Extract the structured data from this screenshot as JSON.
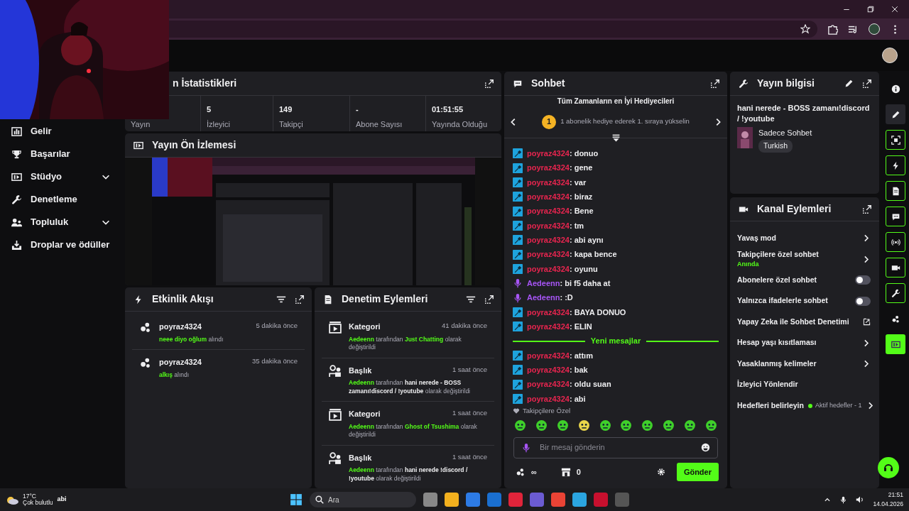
{
  "sidebar": {
    "items": [
      {
        "label": "Gelir",
        "expandable": false
      },
      {
        "label": "Başarılar",
        "expandable": false
      },
      {
        "label": "Stüdyo",
        "expandable": true
      },
      {
        "label": "Denetleme",
        "expandable": false
      },
      {
        "label": "Topluluk",
        "expandable": true
      },
      {
        "label": "Droplar ve ödüller",
        "expandable": false
      }
    ]
  },
  "stats": {
    "title": "n İstatistikleri",
    "items": [
      {
        "label": "Yayın"
      },
      {
        "value": "5",
        "label": "İzleyici"
      },
      {
        "value": "149",
        "label": "Takipçi"
      },
      {
        "value": "-",
        "label": "Abone Sayısı"
      },
      {
        "value": "01:51:55",
        "label": "Yayında Olduğu"
      }
    ]
  },
  "preview": {
    "title": "Yayın Ön İzlemesi"
  },
  "activity": {
    "title": "Etkinlik Akışı",
    "items": [
      {
        "user": "poyraz4324",
        "time": "5 dakika önce",
        "parts": [
          {
            "kind": "accent",
            "text": "neee diyo oğlum"
          },
          {
            "kind": "muted",
            "text": "alındı"
          }
        ]
      },
      {
        "user": "poyraz4324",
        "time": "35 dakika önce",
        "parts": [
          {
            "kind": "accent",
            "text": "alkış"
          },
          {
            "kind": "muted",
            "text": "alındı"
          }
        ]
      }
    ]
  },
  "moderation": {
    "title": "Denetim Eylemleri",
    "items": [
      {
        "kind": "category",
        "title": "Kategori",
        "time": "41 dakika önce",
        "parts": [
          {
            "kind": "accent",
            "text": "Aedeenn"
          },
          {
            "kind": "muted",
            "text": "tarafından"
          },
          {
            "kind": "accent",
            "text": "Just Chatting"
          },
          {
            "kind": "muted",
            "text": "olarak değiştirildi"
          }
        ]
      },
      {
        "kind": "title",
        "title": "Başlık",
        "time": "1 saat önce",
        "parts": [
          {
            "kind": "accent",
            "text": "Aedeenn"
          },
          {
            "kind": "muted",
            "text": "tarafından"
          },
          {
            "kind": "strong",
            "text": "hani nerede - BOSS zamanı!discord / !youtube"
          },
          {
            "kind": "muted",
            "text": "olarak değiştirildi"
          }
        ]
      },
      {
        "kind": "category",
        "title": "Kategori",
        "time": "1 saat önce",
        "parts": [
          {
            "kind": "accent",
            "text": "Aedeenn"
          },
          {
            "kind": "muted",
            "text": "tarafından"
          },
          {
            "kind": "accent",
            "text": "Ghost of Tsushima"
          },
          {
            "kind": "muted",
            "text": "olarak değiştirildi"
          }
        ]
      },
      {
        "kind": "title",
        "title": "Başlık",
        "time": "1 saat önce",
        "parts": [
          {
            "kind": "accent",
            "text": "Aedeenn"
          },
          {
            "kind": "muted",
            "text": "tarafından"
          },
          {
            "kind": "strong",
            "text": "hani nerede !discord / !youtube"
          },
          {
            "kind": "muted",
            "text": "olarak değiştirildi"
          }
        ]
      }
    ]
  },
  "chat": {
    "title": "Sohbet",
    "leaderboard": {
      "title": "Tüm Zamanların en İyi Hediyecileri",
      "rank": "1",
      "text": "1 abonelik hediye ederek 1. sıraya yükselin"
    },
    "messages": [
      {
        "kind": "moderator",
        "user": "poyraz4324",
        "color": "#e8254f",
        "text": ": donuo"
      },
      {
        "kind": "moderator",
        "user": "poyraz4324",
        "color": "#e8254f",
        "text": ": gene"
      },
      {
        "kind": "moderator",
        "user": "poyraz4324",
        "color": "#e8254f",
        "text": ": var"
      },
      {
        "kind": "moderator",
        "user": "poyraz4324",
        "color": "#e8254f",
        "text": ": biraz"
      },
      {
        "kind": "moderator",
        "user": "poyraz4324",
        "color": "#e8254f",
        "text": ": Bene"
      },
      {
        "kind": "moderator",
        "user": "poyraz4324",
        "color": "#e8254f",
        "text": ": tm"
      },
      {
        "kind": "moderator",
        "user": "poyraz4324",
        "color": "#e8254f",
        "text": ": abi aynı"
      },
      {
        "kind": "moderator",
        "user": "poyraz4324",
        "color": "#e8254f",
        "text": ": kapa bence"
      },
      {
        "kind": "moderator",
        "user": "poyraz4324",
        "color": "#e8254f",
        "text": ": oyunu"
      },
      {
        "kind": "broadcaster",
        "user": "Aedeenn",
        "color": "#a855f7",
        "text": ": bi f5 daha at"
      },
      {
        "kind": "broadcaster",
        "user": "Aedeenn",
        "color": "#a855f7",
        "text": ": :D"
      },
      {
        "kind": "moderator",
        "user": "poyraz4324",
        "color": "#e8254f",
        "text": ": BAYA DONUO"
      },
      {
        "kind": "moderator",
        "user": "poyraz4324",
        "color": "#e8254f",
        "text": ": ELIN"
      },
      {
        "kind": "divider",
        "text": "Yeni mesajlar"
      },
      {
        "kind": "moderator",
        "user": "poyraz4324",
        "color": "#e8254f",
        "text": ": attım"
      },
      {
        "kind": "moderator",
        "user": "poyraz4324",
        "color": "#e8254f",
        "text": ": bak"
      },
      {
        "kind": "moderator",
        "user": "poyraz4324",
        "color": "#e8254f",
        "text": ": oldu suan"
      },
      {
        "kind": "moderator",
        "user": "poyraz4324",
        "color": "#e8254f",
        "text": ": abi"
      }
    ],
    "emote_set": "Takipçilere Özel",
    "placeholder": "Bir mesaj gönderin",
    "points": "∞",
    "store_count": "0",
    "send": "Gönder"
  },
  "stream_info": {
    "title": "Yayın bilgisi",
    "stream_title": "hani nerede - BOSS zamanı!discord / !youtube",
    "category": "Sadece Sohbet",
    "tag": "Turkish"
  },
  "channel_actions": {
    "title": "Kanal Eylemleri",
    "items": [
      {
        "kind": "link",
        "label": "Yavaş mod"
      },
      {
        "kind": "link",
        "label": "Takipçilere özel sohbet",
        "sublabel": "Anında"
      },
      {
        "kind": "toggle",
        "label": "Abonelere özel sohbet",
        "on": false
      },
      {
        "kind": "toggle",
        "label": "Yalnızca ifadelerle sohbet",
        "on": false
      },
      {
        "kind": "external",
        "label": "Yapay Zeka ile Sohbet Denetimi"
      },
      {
        "kind": "link",
        "label": "Hesap yaşı kısıtlaması"
      },
      {
        "kind": "link",
        "label": "Yasaklanmış kelimeler"
      },
      {
        "kind": "plain",
        "label": "İzleyici Yönlendir"
      },
      {
        "kind": "link",
        "label": "Hedefleri belirleyin",
        "status": "Aktif hedefler - 1"
      }
    ]
  },
  "taskbar": {
    "temperature": "17°C",
    "weather": "Çok bulutlu",
    "chat_overlay": "abi",
    "search": "Ara",
    "time": "21:51",
    "date": "14.04.2026"
  }
}
